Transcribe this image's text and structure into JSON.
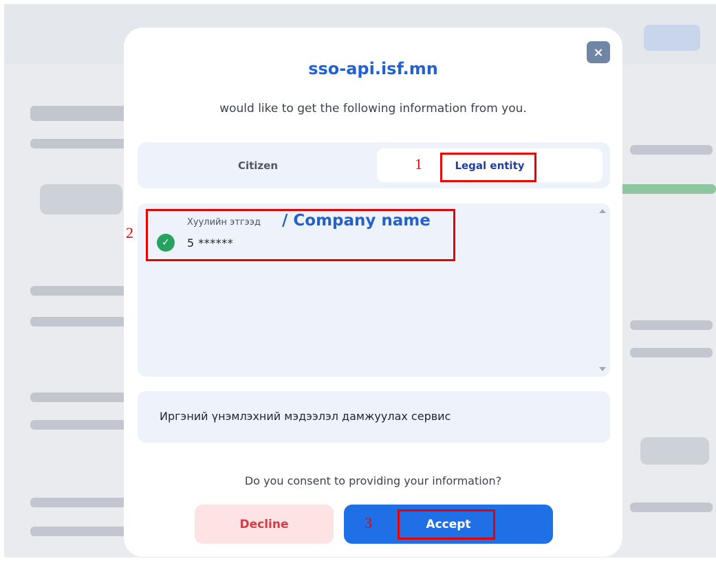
{
  "modal": {
    "title": "sso-api.isf.mn",
    "subtitle": "would like to get the following information from you.",
    "close_glyph": "×"
  },
  "tabs": [
    {
      "label": "Citizen",
      "active": false
    },
    {
      "label": "Legal entity",
      "active": true
    }
  ],
  "entity": {
    "label": "Хуулийн этгээд",
    "company_name": "/ Company name",
    "registration": "5 ******",
    "check_glyph": "✓"
  },
  "service": {
    "text": "Иргэний үнэмлэхний мэдээлэл дамжуулах сервис"
  },
  "consent": {
    "question": "Do you consent to providing your information?",
    "decline_label": "Decline",
    "accept_label": "Accept"
  },
  "annotations": {
    "one": "1",
    "two": "2",
    "three": "3"
  },
  "colors": {
    "primary": "#1f6fe6",
    "title": "#1f62d6",
    "success": "#27a35f",
    "decline_bg": "#fde3e4",
    "decline_text": "#d33b46",
    "annotation": "#e60000"
  }
}
